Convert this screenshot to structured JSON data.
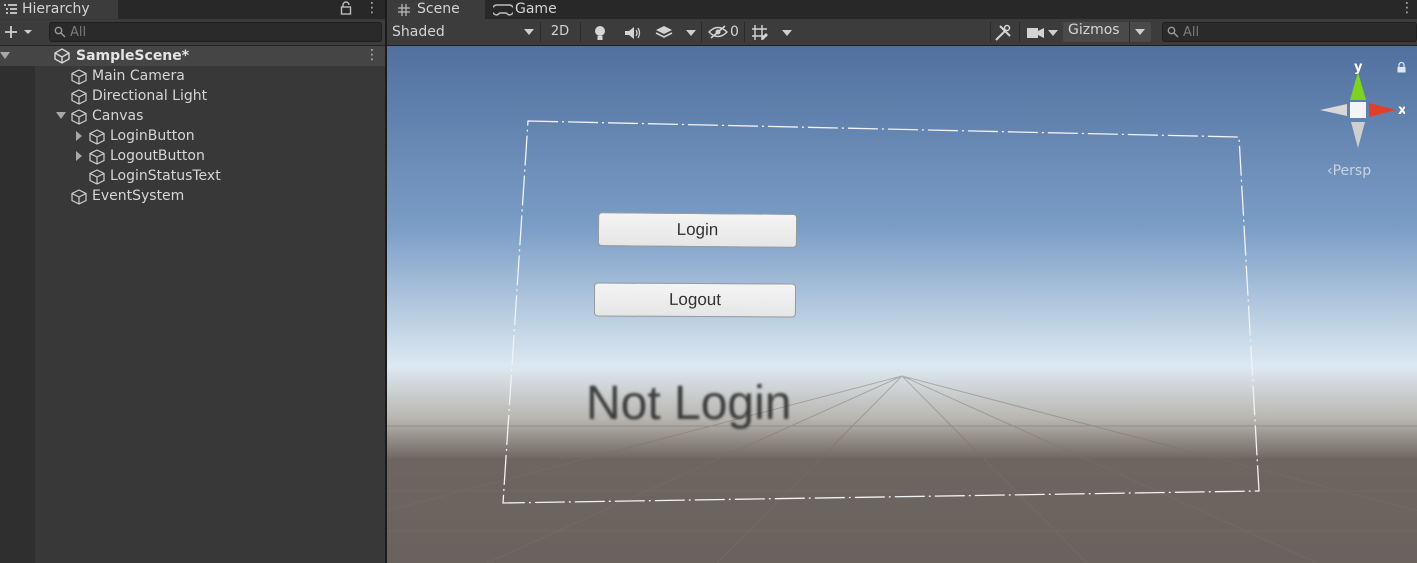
{
  "hierarchy": {
    "tab_title": "Hierarchy",
    "search_placeholder": "All",
    "tree": {
      "scene": "SampleScene*",
      "items": [
        {
          "label": "Main Camera"
        },
        {
          "label": "Directional Light"
        },
        {
          "label": "Canvas"
        },
        {
          "label": "LoginButton"
        },
        {
          "label": "LogoutButton"
        },
        {
          "label": "LoginStatusText"
        },
        {
          "label": "EventSystem"
        }
      ]
    }
  },
  "scene_view": {
    "tabs": [
      {
        "label": "Scene"
      },
      {
        "label": "Game"
      }
    ],
    "toolbar": {
      "shading": "Shaded",
      "mode_2d": "2D",
      "hidden_count": "0",
      "gizmos": "Gizmos",
      "search_placeholder": "All"
    },
    "ui": {
      "login_button": "Login",
      "logout_button": "Logout",
      "status_text": "Not Login"
    },
    "gizmo": {
      "y_label": "y",
      "x_label": "x",
      "projection": "‹Persp"
    }
  },
  "colors": {
    "panel_bg": "#383838",
    "toolbar_bg": "#3c3c3c",
    "selection": "#454545",
    "gizmo_x": "#e0402a",
    "gizmo_y": "#7ed321"
  }
}
